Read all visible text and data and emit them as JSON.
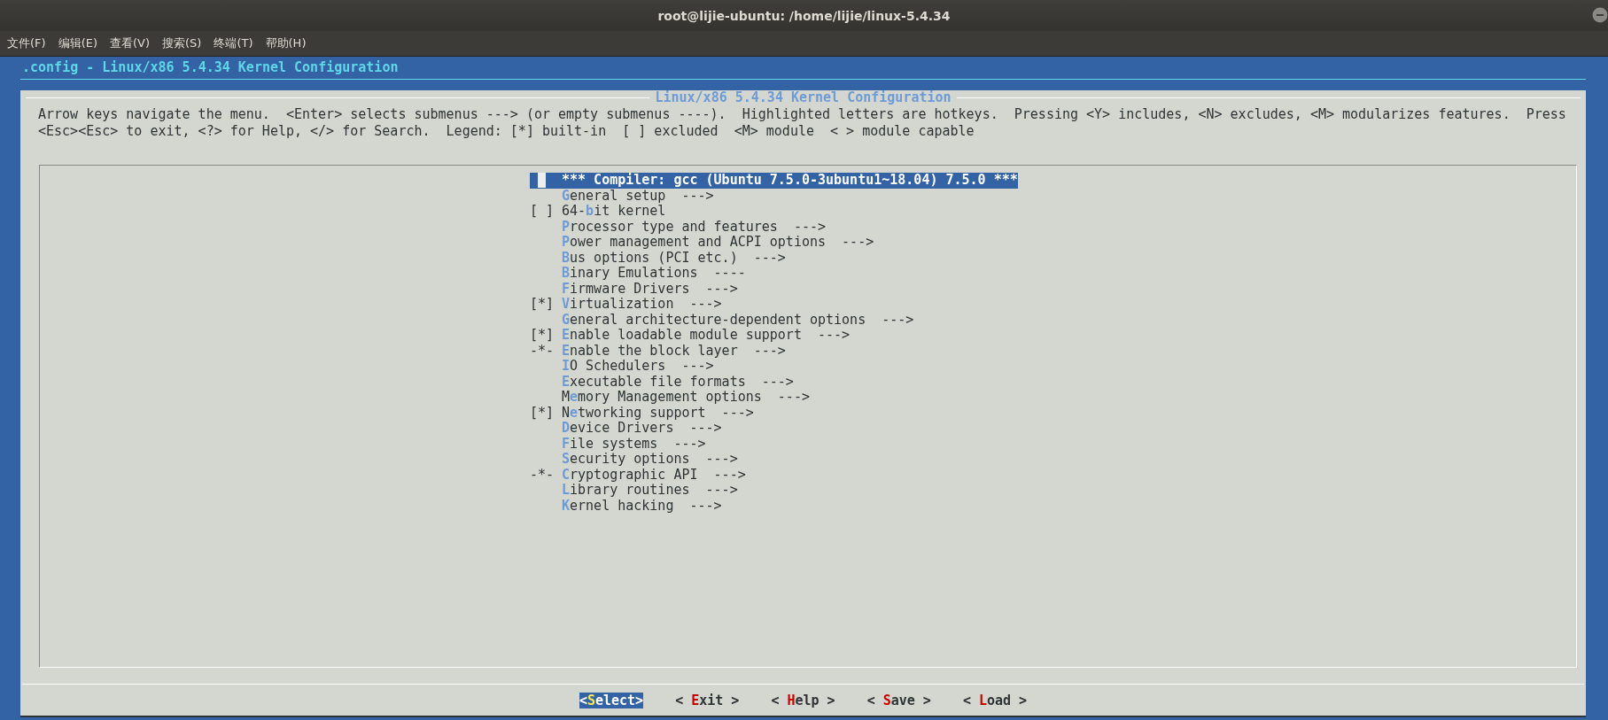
{
  "window": {
    "title": "root@lijie-ubuntu: /home/lijie/linux-5.4.34"
  },
  "menubar": [
    "文件(F)",
    "编辑(E)",
    "查看(V)",
    "搜索(S)",
    "终端(T)",
    "帮助(H)"
  ],
  "header": ".config - Linux/x86 5.4.34 Kernel Configuration",
  "dialog": {
    "title": "Linux/x86 5.4.34 Kernel Configuration",
    "help": [
      "Arrow keys navigate the menu.  <Enter> selects submenus ---> (or empty submenus ----).  Highlighted letters are hotkeys.  Pressing <Y> includes, <N> excludes, <M> modularizes features.  Press",
      "<Esc><Esc> to exit, <?> for Help, </> for Search.  Legend: [*] built-in  [ ] excluded  <M> module  < > module capable"
    ],
    "items": [
      {
        "before": "*** Compiler: gcc (Ubuntu 7.5.0-3ubuntu1~18.04) 7.5.0 ***",
        "selected": true
      },
      {
        "hotkey": "G",
        "after": "eneral setup  --->",
        "selected": false
      },
      {
        "prefix": "[ ]",
        "before": "64-",
        "hotkey": "b",
        "after": "it kernel",
        "selected": false
      },
      {
        "hotkey": "P",
        "after": "rocessor type and features  --->",
        "selected": false
      },
      {
        "hotkey": "P",
        "after": "ower management and ACPI options  --->",
        "selected": false
      },
      {
        "hotkey": "B",
        "after": "us options (PCI etc.)  --->",
        "selected": false
      },
      {
        "hotkey": "B",
        "after": "inary Emulations  ----",
        "selected": false
      },
      {
        "hotkey": "F",
        "after": "irmware Drivers  --->",
        "selected": false
      },
      {
        "prefix": "[*]",
        "hotkey": "V",
        "after": "irtualization  --->",
        "selected": false
      },
      {
        "hotkey": "G",
        "after": "eneral architecture-dependent options  --->",
        "selected": false
      },
      {
        "prefix": "[*]",
        "hotkey": "E",
        "after": "nable loadable module support  --->",
        "selected": false
      },
      {
        "prefix": "-*-",
        "hotkey": "E",
        "after": "nable the block layer  --->",
        "selected": false
      },
      {
        "hotkey": "I",
        "after": "O Schedulers  --->",
        "selected": false
      },
      {
        "hotkey": "E",
        "after": "xecutable file formats  --->",
        "selected": false
      },
      {
        "before": "M",
        "hotkey": "e",
        "after": "mory Management options  --->",
        "selected": false
      },
      {
        "prefix": "[*]",
        "before": "N",
        "hotkey": "e",
        "after": "tworking support  --->",
        "selected": false
      },
      {
        "hotkey": "D",
        "after": "evice Drivers  --->",
        "selected": false
      },
      {
        "hotkey": "F",
        "after": "ile systems  --->",
        "selected": false
      },
      {
        "hotkey": "S",
        "after": "ecurity options  --->",
        "selected": false
      },
      {
        "prefix": "-*-",
        "hotkey": "C",
        "after": "ryptographic API  --->",
        "selected": false
      },
      {
        "hotkey": "L",
        "after": "ibrary routines  --->",
        "selected": false
      },
      {
        "hotkey": "K",
        "after": "ernel hacking  --->",
        "selected": false
      }
    ],
    "buttons": [
      {
        "before": "<",
        "hotkey": "S",
        "after": "elect>",
        "selected": true
      },
      {
        "before": "< ",
        "hotkey": "E",
        "after": "xit >",
        "selected": false
      },
      {
        "before": "< ",
        "hotkey": "H",
        "after": "elp >",
        "selected": false
      },
      {
        "before": "< ",
        "hotkey": "S",
        "after": "ave >",
        "selected": false
      },
      {
        "before": "< ",
        "hotkey": "L",
        "after": "oad >",
        "selected": false
      }
    ]
  }
}
